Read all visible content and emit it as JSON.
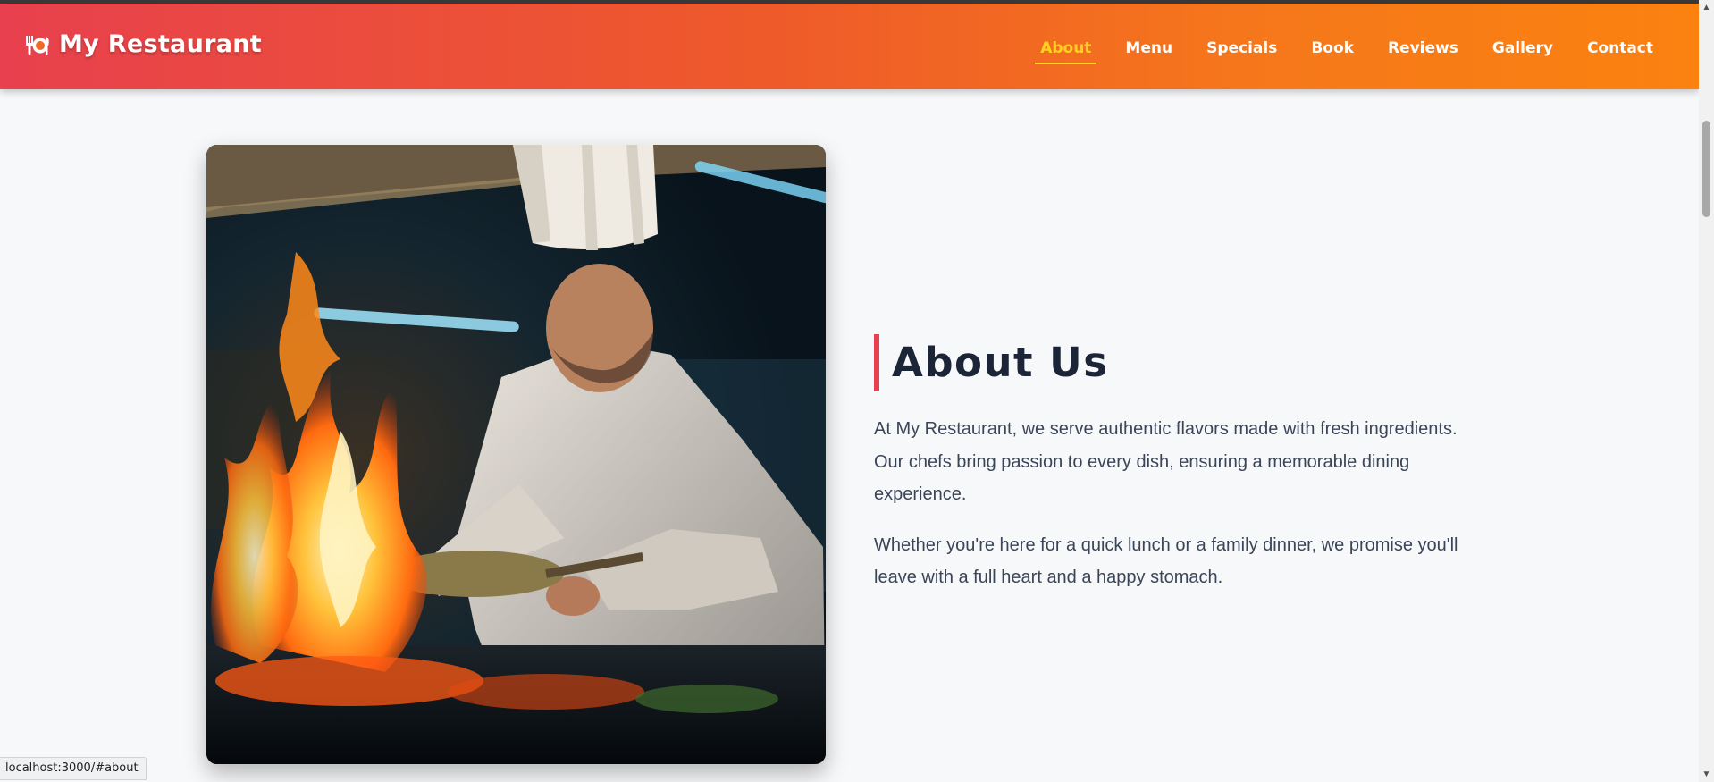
{
  "header": {
    "brand_icon": "plate-cutlery-icon",
    "brand_name": "My Restaurant",
    "nav": [
      {
        "label": "About",
        "active": true
      },
      {
        "label": "Menu",
        "active": false
      },
      {
        "label": "Specials",
        "active": false
      },
      {
        "label": "Book",
        "active": false
      },
      {
        "label": "Reviews",
        "active": false
      },
      {
        "label": "Gallery",
        "active": false
      },
      {
        "label": "Contact",
        "active": false
      }
    ]
  },
  "about": {
    "image_alt": "Chef flambéing food in a kitchen",
    "heading": "About Us",
    "paragraph1": "At My Restaurant, we serve authentic flavors made with fresh ingredients. Our chefs bring passion to every dish, ensuring a memorable dining experience.",
    "paragraph2": "Whether you're here for a quick lunch or a family dinner, we promise you'll leave with a full heart and a happy stomach."
  },
  "status_bar": {
    "url": "localhost:3000/#about"
  },
  "colors": {
    "gradient_start": "#e8404e",
    "gradient_end": "#fb8210",
    "active_nav": "#ffd21f",
    "heading": "#1c2537",
    "heading_accent": "#e8404e",
    "body_text": "#3b4558",
    "page_bg": "#f7f8fa"
  }
}
